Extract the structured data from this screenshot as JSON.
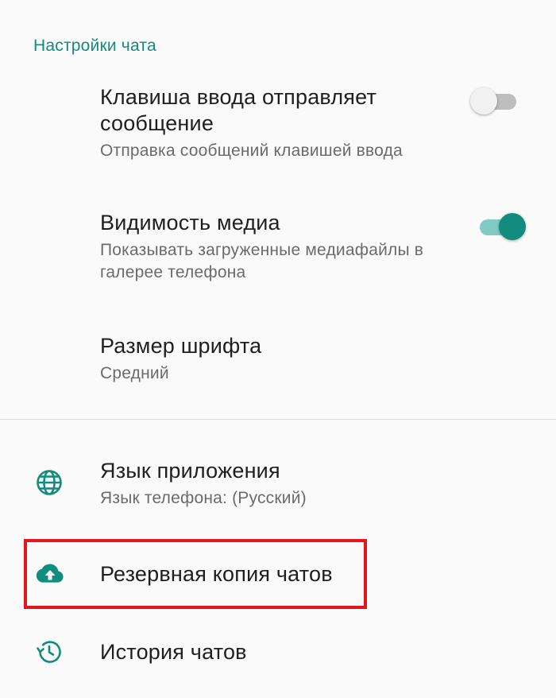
{
  "section": {
    "title": "Настройки чата"
  },
  "settings": {
    "enter_key": {
      "title": "Клавиша ввода отправляет сообщение",
      "subtitle": "Отправка сообщений клавишей ввода",
      "enabled": false
    },
    "media_visibility": {
      "title": "Видимость медиа",
      "subtitle": "Показывать загруженные медиафайлы в галерее телефона",
      "enabled": true
    },
    "font_size": {
      "title": "Размер шрифта",
      "subtitle": "Средний"
    }
  },
  "menu": {
    "language": {
      "title": "Язык приложения",
      "subtitle": "Язык телефона: (Русский)",
      "icon": "globe-icon"
    },
    "backup": {
      "title": "Резервная копия чатов",
      "icon": "cloud-upload-icon"
    },
    "history": {
      "title": "История чатов",
      "icon": "history-icon"
    }
  },
  "colors": {
    "accent": "#128c7e",
    "highlight": "#e3161e"
  }
}
